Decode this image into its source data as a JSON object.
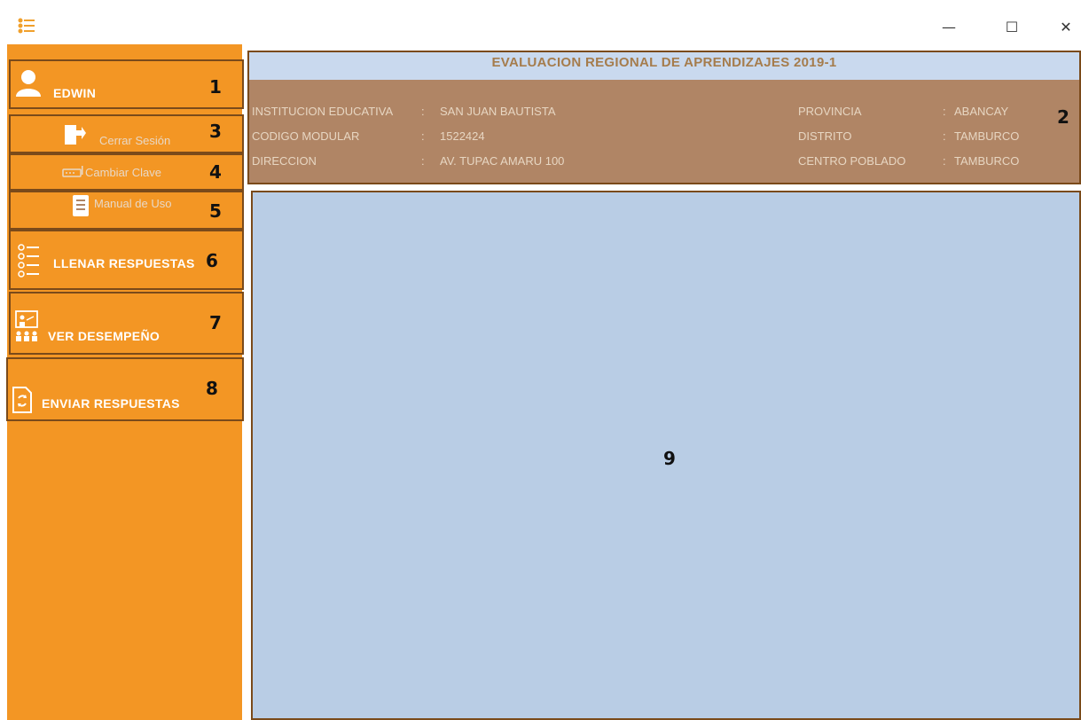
{
  "window": {
    "minimize_glyph": "—",
    "maximize_glyph": "☐",
    "close_glyph": "✕"
  },
  "sidebar": {
    "user_name": "EDWIN",
    "logout_label": "Cerrar Sesión",
    "change_password_label": "Cambiar Clave",
    "manual_label": "Manual de Uso",
    "fill_answers_label": "LLENAR RESPUESTAS",
    "view_performance_label": "VER DESEMPEÑO",
    "send_answers_label": "ENVIAR RESPUESTAS"
  },
  "header": {
    "title": "EVALUACION REGIONAL DE APRENDIZAJES 2019-1",
    "institution_label": "INSTITUCION EDUCATIVA",
    "institution_value": "SAN JUAN BAUTISTA",
    "code_label": "CODIGO MODULAR",
    "code_value": "1522424",
    "address_label": "DIRECCION",
    "address_value": "AV. TUPAC AMARU 100",
    "province_label": "PROVINCIA",
    "province_value": "ABANCAY",
    "district_label": "DISTRITO",
    "district_value": "TAMBURCO",
    "town_label": "CENTRO POBLADO",
    "town_value": "TAMBURCO",
    "separator": ":"
  },
  "annotations": [
    "1",
    "2",
    "3",
    "4",
    "5",
    "6",
    "7",
    "8",
    "9"
  ],
  "colors": {
    "sidebar": "#f39624",
    "header_band": "#b08565",
    "title_bar": "#c9d9ee",
    "content": "#b9cde5",
    "annotation_border": "#7a4a1a"
  }
}
